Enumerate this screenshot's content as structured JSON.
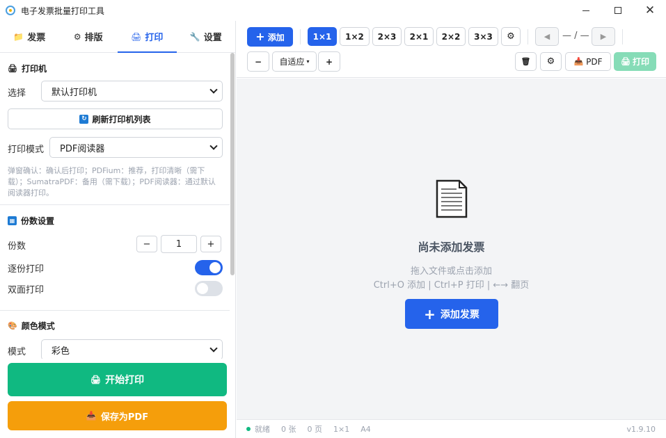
{
  "window": {
    "title": "电子发票批量打印工具"
  },
  "tabs": [
    {
      "icon": "folder-icon",
      "label": "发票"
    },
    {
      "icon": "gear-icon",
      "label": "排版"
    },
    {
      "icon": "printer-icon",
      "label": "打印"
    },
    {
      "icon": "wrench-icon",
      "label": "设置"
    }
  ],
  "printer": {
    "section_title": "打印机",
    "select_label": "选择",
    "select_value": "默认打印机",
    "refresh_label": "刷新打印机列表",
    "mode_label": "打印模式",
    "mode_value": "PDF阅读器",
    "hint": "弹窗确认：确认后打印；PDFium：推荐，打印清晰（需下载）；SumatraPDF：备用（需下载）；PDF阅读器：通过默认阅读器打印。"
  },
  "copies": {
    "section_title": "份数设置",
    "count_label": "份数",
    "minus": "−",
    "value": "1",
    "plus": "+",
    "collate_label": "逐份打印",
    "collate_on": true,
    "duplex_label": "双面打印",
    "duplex_on": false
  },
  "color": {
    "section_title": "颜色模式",
    "mode_label": "模式",
    "mode_value": "彩色"
  },
  "actions": {
    "print_label": "开始打印",
    "save_pdf_label": "保存为PDF"
  },
  "toolbar": {
    "add_label": "添加",
    "layouts": [
      "1×1",
      "1×2",
      "2×3",
      "2×1",
      "2×2",
      "3×3"
    ],
    "active_layout": "1×1",
    "page_indicator": "— / —",
    "zoom_minus": "−",
    "zoom_value": "自适应",
    "zoom_plus": "+",
    "pdf_label": "PDF",
    "print_label": "打印"
  },
  "canvas": {
    "empty_title": "尚未添加发票",
    "empty_sub1": "拖入文件或点击添加",
    "empty_sub2": "Ctrl+O 添加 | Ctrl+P 打印 | ←→ 翻页",
    "add_invoice_label": "添加发票"
  },
  "status": {
    "state": "就绪",
    "count": "0 张",
    "pages": "0 页",
    "layout": "1×1",
    "paper": "A4",
    "version": "v1.9.10"
  },
  "colors": {
    "primary": "#2563eb",
    "success": "#10b981",
    "warning": "#f59e0b"
  }
}
